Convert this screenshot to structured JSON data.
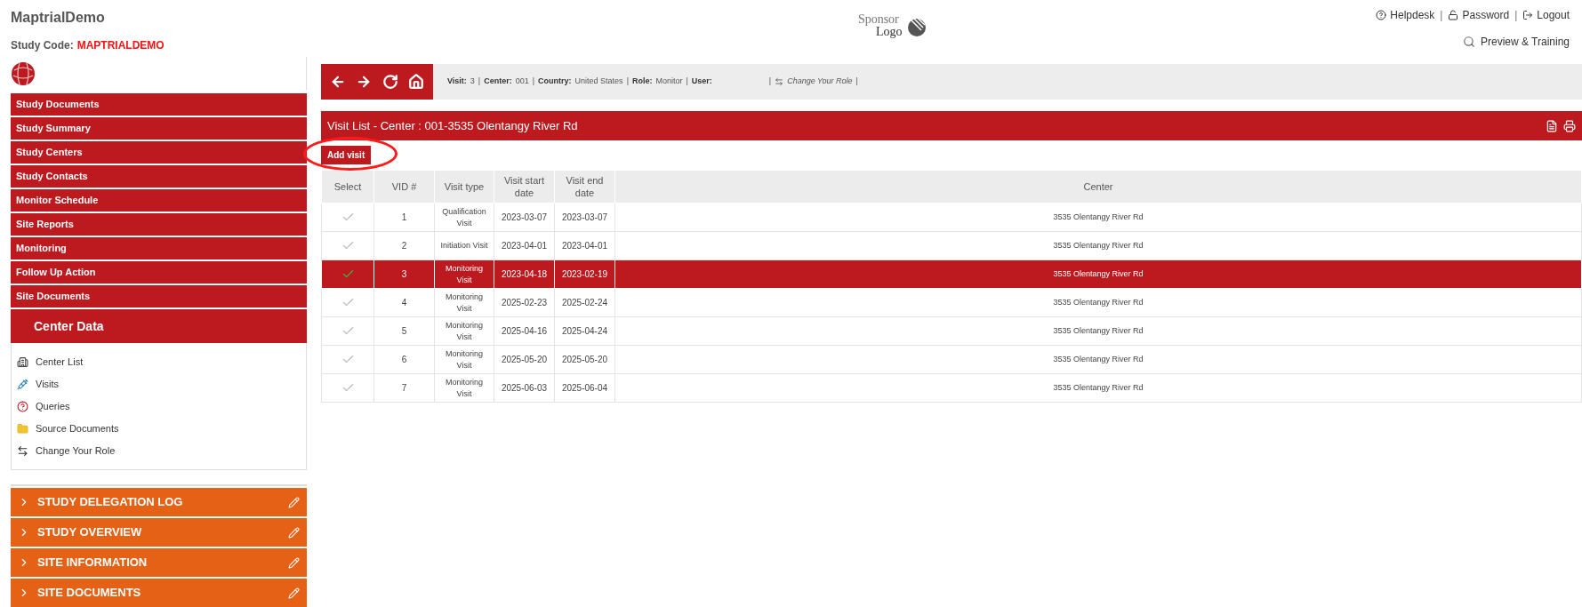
{
  "header": {
    "title": "MaptrialDemo",
    "study_code_label": "Study Code:",
    "study_code": "MAPTRIALDEMO",
    "sponsor_logo": [
      "Sponsor",
      "Logo"
    ],
    "links": [
      {
        "kind": "help",
        "label": "Helpdesk"
      },
      {
        "kind": "lock",
        "label": "Password"
      },
      {
        "kind": "logout",
        "label": "Logout"
      }
    ],
    "separator": "|",
    "preview": "Preview & Training"
  },
  "toolbar": {
    "buttons": [
      {
        "kind": "back"
      },
      {
        "kind": "forward"
      },
      {
        "kind": "refresh"
      },
      {
        "kind": "home"
      }
    ],
    "context": [
      {
        "label": "Visit:",
        "value": "3"
      },
      {
        "label": "Center:",
        "value": "001"
      },
      {
        "label": "Country:",
        "value": "United States"
      },
      {
        "label": "Role:",
        "value": "Monitor"
      },
      {
        "label": "User:"
      }
    ],
    "separator": "|",
    "change_role": "Change Your Role"
  },
  "sidebar": {
    "menu": [
      {
        "label": "Study Documents"
      },
      {
        "label": "Study Summary"
      },
      {
        "label": "Study Centers"
      },
      {
        "label": "Study Contacts"
      },
      {
        "label": "Monitor Schedule"
      },
      {
        "label": "Site Reports"
      },
      {
        "label": "Monitoring"
      },
      {
        "label": "Follow Up Action"
      },
      {
        "label": "Site Documents"
      }
    ],
    "center_data": {
      "title": "Center Data",
      "items": [
        {
          "kind": "building",
          "label": "Center List"
        },
        {
          "kind": "syringe",
          "label": "Visits"
        },
        {
          "kind": "question",
          "label": "Queries"
        },
        {
          "kind": "folder",
          "label": "Source Documents"
        },
        {
          "kind": "swap",
          "label": "Change Your Role"
        }
      ]
    },
    "sections": [
      {
        "label": "STUDY DELEGATION LOG",
        "expanded": false
      },
      {
        "label": "STUDY OVERVIEW",
        "expanded": false
      },
      {
        "label": "SITE INFORMATION",
        "expanded": false
      },
      {
        "label": "SITE DOCUMENTS",
        "expanded": false
      }
    ]
  },
  "panel": {
    "title": "Visit List - Center : 001-3535 Olentangy River Rd",
    "add_button": "Add visit",
    "table": {
      "columns": [
        "Select",
        "VID #",
        "Visit type",
        "Visit start date",
        "Visit end date",
        "Center"
      ],
      "rows": [
        {
          "selected": false,
          "vid": "1",
          "type": "Qualification Visit",
          "start": "2023-03-07",
          "end": "2023-03-07",
          "center": "3535 Olentangy River Rd"
        },
        {
          "selected": false,
          "vid": "2",
          "type": "Initiation Visit",
          "start": "2023-04-01",
          "end": "2023-04-01",
          "center": "3535 Olentangy River Rd"
        },
        {
          "selected": true,
          "vid": "3",
          "type": "Monitoring Visit",
          "start": "2023-04-18",
          "end": "2023-02-19",
          "center": "3535 Olentangy River Rd"
        },
        {
          "selected": false,
          "vid": "4",
          "type": "Monitoring Visit",
          "start": "2025-02-23",
          "end": "2025-02-24",
          "center": "3535 Olentangy River Rd"
        },
        {
          "selected": false,
          "vid": "5",
          "type": "Monitoring Visit",
          "start": "2025-04-16",
          "end": "2025-04-24",
          "center": "3535 Olentangy River Rd"
        },
        {
          "selected": false,
          "vid": "6",
          "type": "Monitoring Visit",
          "start": "2025-05-20",
          "end": "2025-05-20",
          "center": "3535 Olentangy River Rd"
        },
        {
          "selected": false,
          "vid": "7",
          "type": "Monitoring Visit",
          "start": "2025-06-03",
          "end": "2025-06-04",
          "center": "3535 Olentangy River Rd"
        }
      ]
    }
  }
}
